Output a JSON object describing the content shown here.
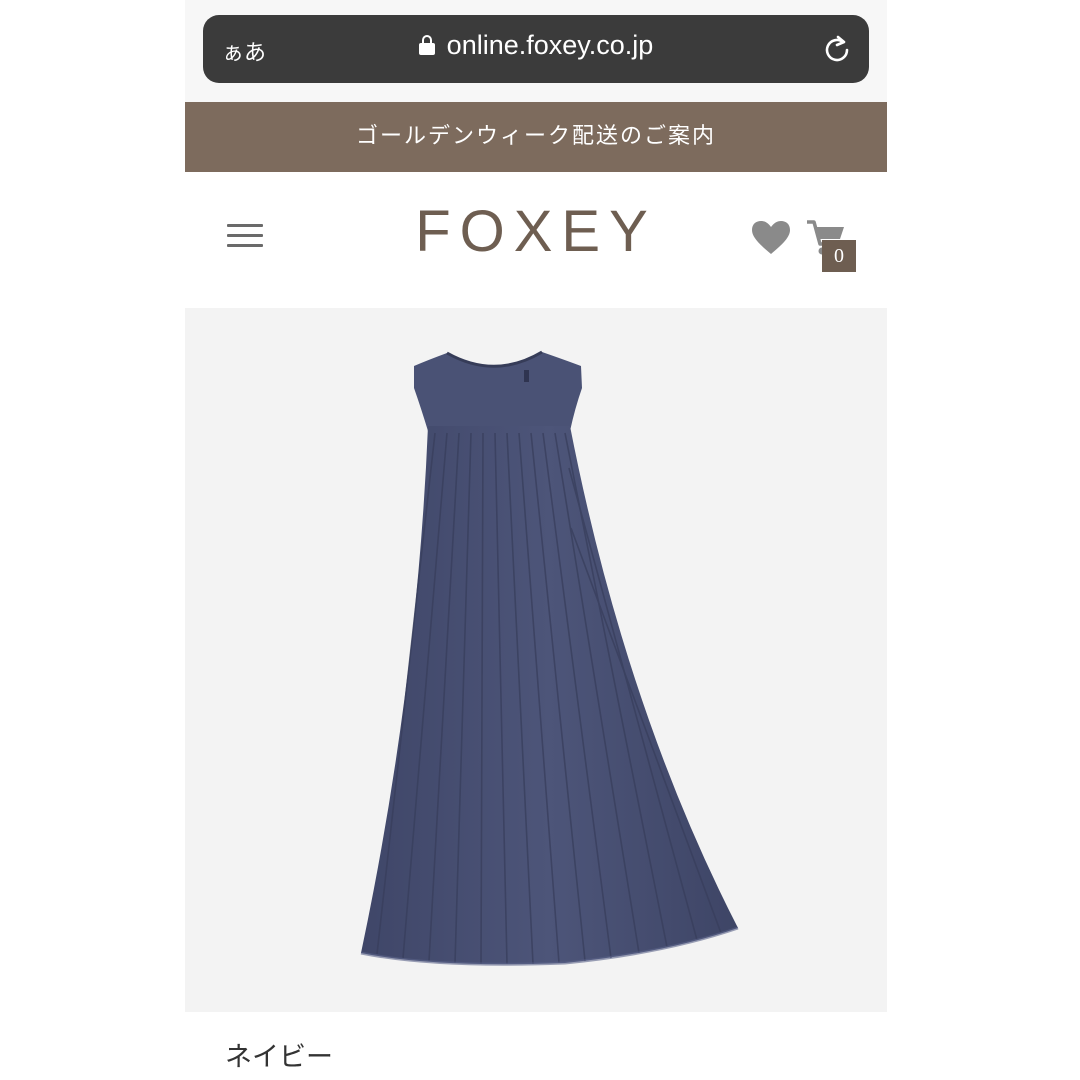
{
  "browser": {
    "text_size_label": "ぁあ",
    "url": "online.foxey.co.jp"
  },
  "banner": {
    "text": "ゴールデンウィーク配送のご案内"
  },
  "header": {
    "logo": "FOXEY",
    "cart_count": "0"
  },
  "product": {
    "color_label": "ネイビー",
    "dress_color": "#4a5275"
  },
  "colors": {
    "banner_bg": "#7d6b5d",
    "brand": "#6e5e51",
    "address_bar_bg": "#3b3b3b"
  },
  "icons": [
    "lock-icon",
    "reload-icon",
    "menu-icon",
    "heart-icon",
    "cart-icon"
  ]
}
